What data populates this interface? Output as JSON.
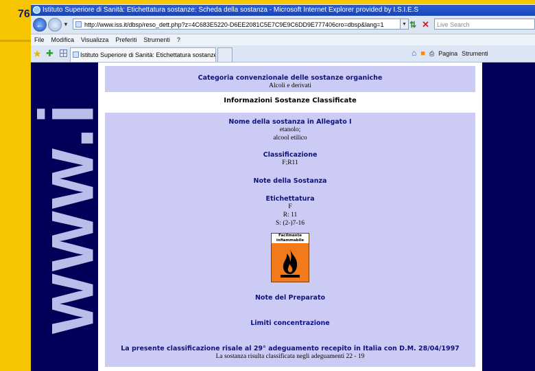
{
  "slide": {
    "number": "76"
  },
  "browser": {
    "window_title": "Istituto Superiore di Sanità: Etichettatura sostanze: Scheda della sostanza - Microsoft Internet Explorer provided by I.S.I.E.S",
    "url": "http://www.iss.it/dbsp/reso_dett.php?z=4C683E5220-D6EE2081C5E7C9E9C6DD9E777406cro=dbsp&lang=1",
    "search_placeholder": "Live Search",
    "menu": [
      "File",
      "Modifica",
      "Visualizza",
      "Preferiti",
      "Strumenti",
      "?"
    ],
    "tab_title": "Istituto Superiore di Sanità: Etichettatura sostanze: S...",
    "cmd_page": "Pagina",
    "cmd_tools": "Strumenti"
  },
  "page": {
    "banner_text": "www.i",
    "category": {
      "heading": "Categoria convenzionale delle sostanze organiche",
      "value": "Alcoli e derivati"
    },
    "info_heading": "Informazioni Sostanze Classificate",
    "substance": {
      "heading": "Nome della sostanza in Allegato I",
      "names": [
        "etanolo;",
        "alcool etilico"
      ]
    },
    "classification": {
      "heading": "Classificazione",
      "value": "F;R11"
    },
    "substance_notes": {
      "heading": "Note della Sostanza"
    },
    "labelling": {
      "heading": "Etichettatura",
      "lines": [
        "F",
        "R: 11",
        "S: (2-)7-16"
      ]
    },
    "hazard_symbol": {
      "label": "Facilmente infiammabile",
      "icon": "flame-icon"
    },
    "preparation_notes": {
      "heading": "Note del Preparato"
    },
    "concentration_limits": {
      "heading": "Limiti concentrazione"
    },
    "footer": {
      "heading": "La presente classificazione risale al 29° adeguamento recepito in Italia con D.M. 28/04/1997",
      "note": "La sostanza risulta classificata negli adeguamenti 22 - 19"
    }
  }
}
